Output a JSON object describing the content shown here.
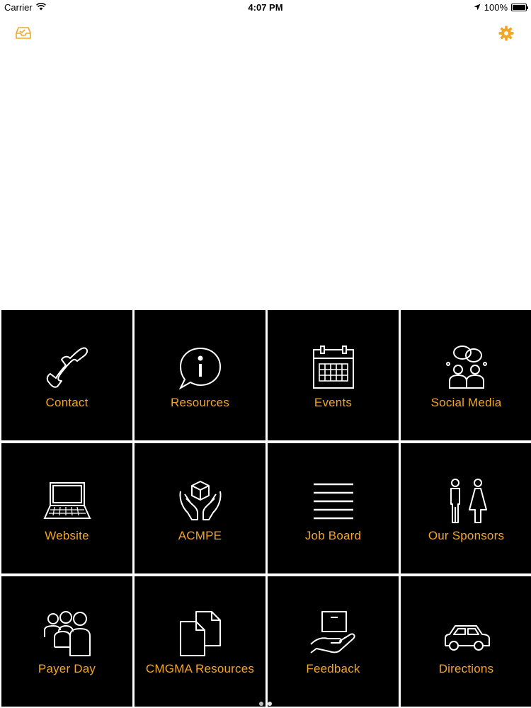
{
  "status_bar": {
    "carrier": "Carrier",
    "time": "4:07 PM",
    "battery": "100%",
    "battery_level": 1.0
  },
  "nav": {
    "left_icon": "inbox-icon",
    "right_icon": "gear-icon"
  },
  "tiles": [
    {
      "label": "Contact",
      "icon": "phone-icon"
    },
    {
      "label": "Resources",
      "icon": "info-bubble-icon"
    },
    {
      "label": "Events",
      "icon": "calendar-icon"
    },
    {
      "label": "Social Media",
      "icon": "people-chat-icon"
    },
    {
      "label": "Website",
      "icon": "laptop-icon"
    },
    {
      "label": "ACMPE",
      "icon": "hands-box-icon"
    },
    {
      "label": "Job Board",
      "icon": "lines-icon"
    },
    {
      "label": "Our Sponsors",
      "icon": "man-woman-icon"
    },
    {
      "label": "Payer Day",
      "icon": "group-icon"
    },
    {
      "label": "CMGMA Resources",
      "icon": "documents-icon"
    },
    {
      "label": "Feedback",
      "icon": "hand-box-icon"
    },
    {
      "label": "Directions",
      "icon": "car-icon"
    }
  ],
  "page_indicator": {
    "pages": 2,
    "current": 1
  },
  "colors": {
    "accent": "#F2A623",
    "tile_bg": "#000000",
    "icon_stroke": "#FFFFFF",
    "dot_active": "#BDBDBD",
    "dot_inactive": "#E6E6E6"
  }
}
